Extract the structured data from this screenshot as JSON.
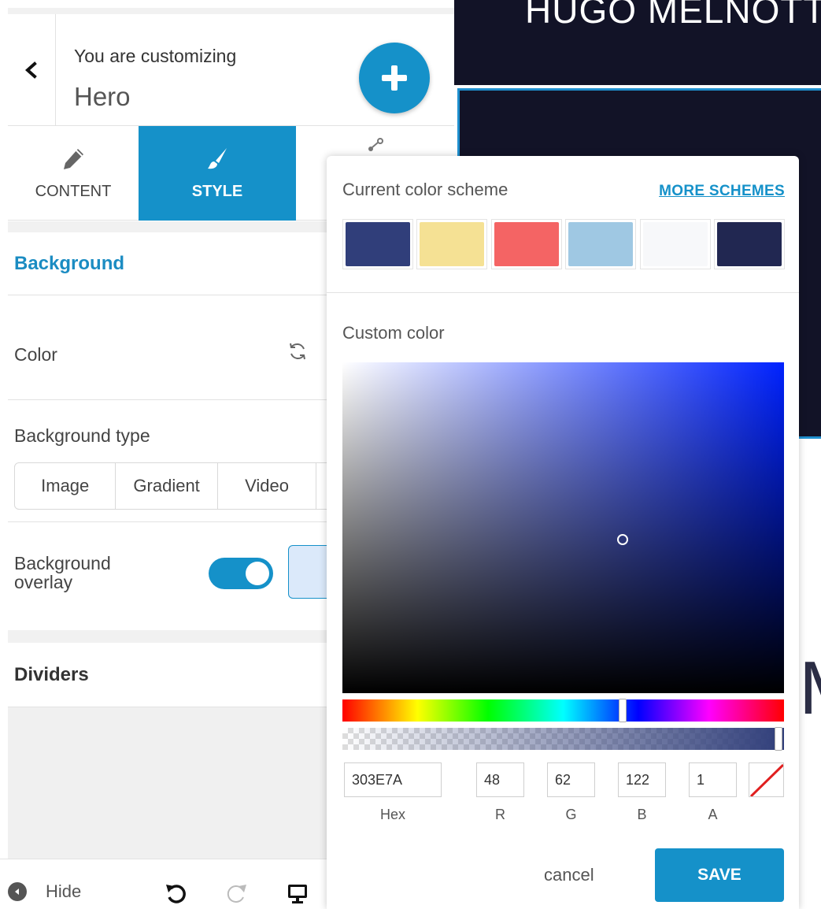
{
  "preview": {
    "site_title": "HUGO MELNOTTI",
    "big_letter": "M"
  },
  "header": {
    "subtitle": "You are customizing",
    "title": "Hero"
  },
  "tabs": [
    {
      "label": "CONTENT"
    },
    {
      "label": "STYLE"
    },
    {
      "label": ""
    }
  ],
  "background": {
    "heading": "Background",
    "color_label": "Color",
    "type_label": "Background type",
    "types": [
      "Image",
      "Gradient",
      "Video",
      ""
    ],
    "overlay_label": "Background overlay",
    "overlay_enabled": true
  },
  "dividers": {
    "heading": "Dividers"
  },
  "footer": {
    "hide_label": "Hide"
  },
  "picker": {
    "scheme_label": "Current color scheme",
    "more_schemes": "MORE SCHEMES",
    "scheme_colors": [
      "#303E7A",
      "#F5E194",
      "#F46464",
      "#9FC8E3",
      "#F7F8FA",
      "#212751"
    ],
    "custom_label": "Custom color",
    "hex": "303E7A",
    "r": "48",
    "g": "62",
    "b": "122",
    "a": "1",
    "labels": {
      "hex": "Hex",
      "r": "R",
      "g": "G",
      "b": "B",
      "a": "A"
    },
    "cancel": "cancel",
    "save": "SAVE"
  },
  "colors": {
    "accent": "#1591C9",
    "preview_dark": "#121327"
  }
}
